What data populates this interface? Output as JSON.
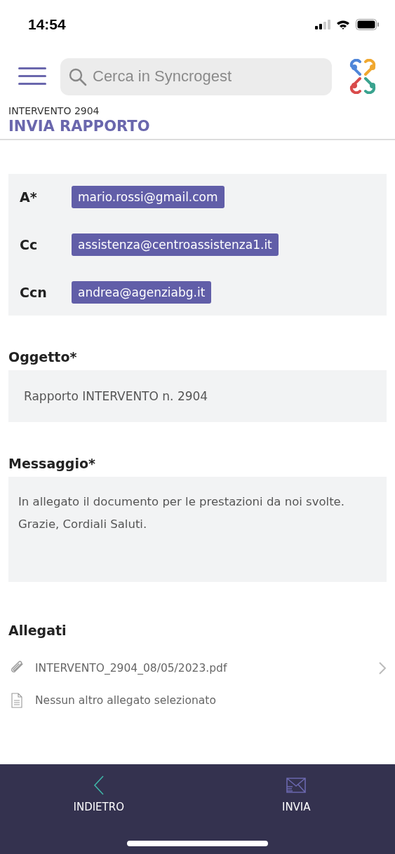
{
  "status_bar": {
    "time": "14:54"
  },
  "search": {
    "placeholder": "Cerca in Syncrogest"
  },
  "header": {
    "subtitle": "INTERVENTO 2904",
    "title": "INVIA RAPPORTO"
  },
  "recipients": [
    {
      "label": "A*",
      "email": "mario.rossi@gmail.com"
    },
    {
      "label": "Cc",
      "email": "assistenza@centroassistenza1.it"
    },
    {
      "label": "Ccn",
      "email": "andrea@agenziabg.it"
    }
  ],
  "subject": {
    "label": "Oggetto*",
    "value": "Rapporto INTERVENTO n. 2904"
  },
  "message": {
    "label": "Messaggio*",
    "value": "In allegato il documento per le prestazioni da noi svolte.\nGrazie, Cordiali Saluti."
  },
  "attachments": {
    "label": "Allegati",
    "items": [
      {
        "kind": "file",
        "text": "INTERVENTO_2904_08/05/2023.pdf"
      },
      {
        "kind": "empty",
        "text": "Nessun altro allegato selezionato"
      }
    ]
  },
  "bottom_bar": [
    {
      "kind": "back",
      "label": "INDIETRO"
    },
    {
      "kind": "send",
      "label": "INVIA"
    }
  ]
}
